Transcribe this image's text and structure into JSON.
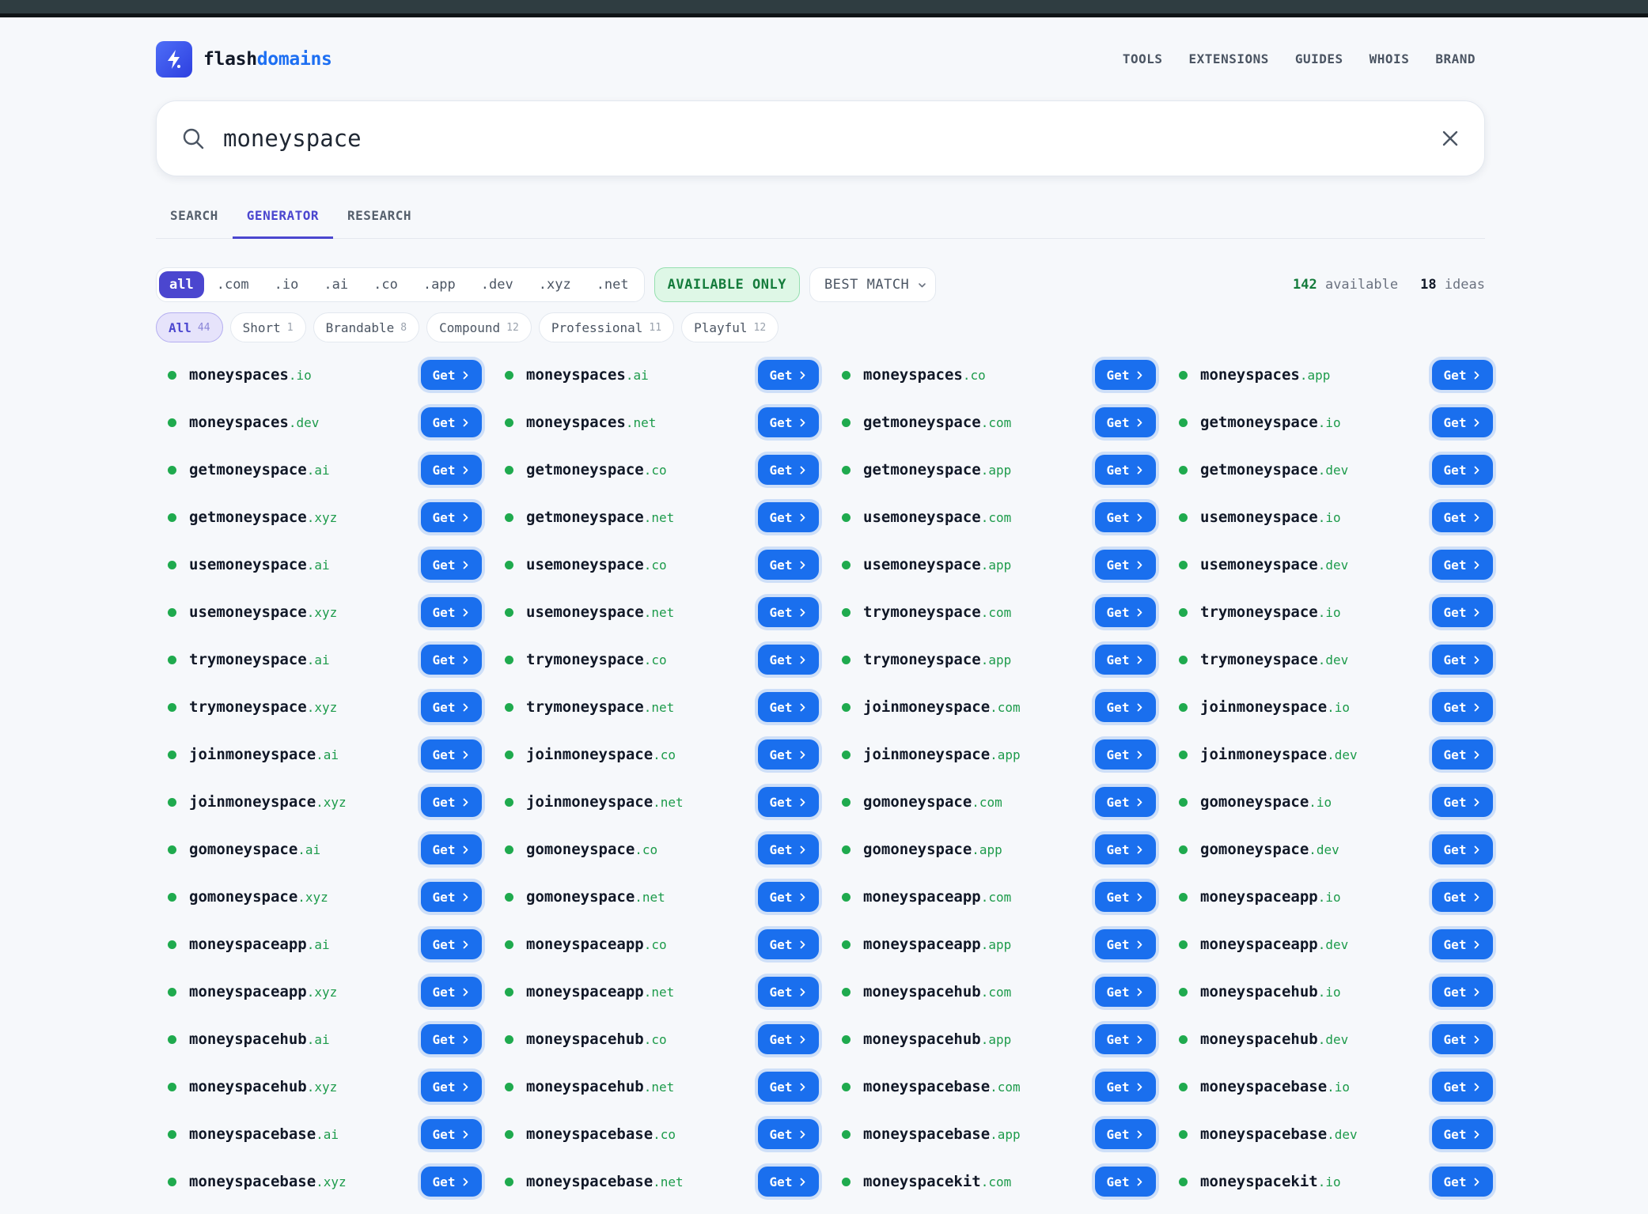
{
  "brand": {
    "name_part1": "flash",
    "name_part2": "domains",
    "accent": "#1d6ff2"
  },
  "nav": [
    "TOOLS",
    "EXTENSIONS",
    "GUIDES",
    "WHOIS",
    "BRAND"
  ],
  "search": {
    "value": "moneyspace"
  },
  "tabs": [
    {
      "label": "SEARCH",
      "active": false
    },
    {
      "label": "GENERATOR",
      "active": true
    },
    {
      "label": "RESEARCH",
      "active": false
    }
  ],
  "tld_filters": [
    {
      "label": "all",
      "active": true
    },
    {
      "label": ".com",
      "active": false
    },
    {
      "label": ".io",
      "active": false
    },
    {
      "label": ".ai",
      "active": false
    },
    {
      "label": ".co",
      "active": false
    },
    {
      "label": ".app",
      "active": false
    },
    {
      "label": ".dev",
      "active": false
    },
    {
      "label": ".xyz",
      "active": false
    },
    {
      "label": ".net",
      "active": false
    }
  ],
  "available_only_label": "AVAILABLE ONLY",
  "sort": {
    "selected": "BEST MATCH"
  },
  "stats": {
    "available_count": "142",
    "available_label": "available",
    "ideas_count": "18",
    "ideas_label": "ideas"
  },
  "categories": [
    {
      "label": "All",
      "count": "44",
      "active": true
    },
    {
      "label": "Short",
      "count": "1",
      "active": false
    },
    {
      "label": "Brandable",
      "count": "8",
      "active": false
    },
    {
      "label": "Compound",
      "count": "12",
      "active": false
    },
    {
      "label": "Professional",
      "count": "11",
      "active": false
    },
    {
      "label": "Playful",
      "count": "12",
      "active": false
    }
  ],
  "get_label": "Get",
  "status_color": "#1faa4e",
  "domains": [
    {
      "base": "moneyspaces",
      "tld": ".io"
    },
    {
      "base": "moneyspaces",
      "tld": ".ai"
    },
    {
      "base": "moneyspaces",
      "tld": ".co"
    },
    {
      "base": "moneyspaces",
      "tld": ".app"
    },
    {
      "base": "moneyspaces",
      "tld": ".dev"
    },
    {
      "base": "moneyspaces",
      "tld": ".net"
    },
    {
      "base": "getmoneyspace",
      "tld": ".com"
    },
    {
      "base": "getmoneyspace",
      "tld": ".io"
    },
    {
      "base": "getmoneyspace",
      "tld": ".ai"
    },
    {
      "base": "getmoneyspace",
      "tld": ".co"
    },
    {
      "base": "getmoneyspace",
      "tld": ".app"
    },
    {
      "base": "getmoneyspace",
      "tld": ".dev"
    },
    {
      "base": "getmoneyspace",
      "tld": ".xyz"
    },
    {
      "base": "getmoneyspace",
      "tld": ".net"
    },
    {
      "base": "usemoneyspace",
      "tld": ".com"
    },
    {
      "base": "usemoneyspace",
      "tld": ".io"
    },
    {
      "base": "usemoneyspace",
      "tld": ".ai"
    },
    {
      "base": "usemoneyspace",
      "tld": ".co"
    },
    {
      "base": "usemoneyspace",
      "tld": ".app"
    },
    {
      "base": "usemoneyspace",
      "tld": ".dev"
    },
    {
      "base": "usemoneyspace",
      "tld": ".xyz"
    },
    {
      "base": "usemoneyspace",
      "tld": ".net"
    },
    {
      "base": "trymoneyspace",
      "tld": ".com"
    },
    {
      "base": "trymoneyspace",
      "tld": ".io"
    },
    {
      "base": "trymoneyspace",
      "tld": ".ai"
    },
    {
      "base": "trymoneyspace",
      "tld": ".co"
    },
    {
      "base": "trymoneyspace",
      "tld": ".app"
    },
    {
      "base": "trymoneyspace",
      "tld": ".dev"
    },
    {
      "base": "trymoneyspace",
      "tld": ".xyz"
    },
    {
      "base": "trymoneyspace",
      "tld": ".net"
    },
    {
      "base": "joinmoneyspace",
      "tld": ".com"
    },
    {
      "base": "joinmoneyspace",
      "tld": ".io"
    },
    {
      "base": "joinmoneyspace",
      "tld": ".ai"
    },
    {
      "base": "joinmoneyspace",
      "tld": ".co"
    },
    {
      "base": "joinmoneyspace",
      "tld": ".app"
    },
    {
      "base": "joinmoneyspace",
      "tld": ".dev"
    },
    {
      "base": "joinmoneyspace",
      "tld": ".xyz"
    },
    {
      "base": "joinmoneyspace",
      "tld": ".net"
    },
    {
      "base": "gomoneyspace",
      "tld": ".com"
    },
    {
      "base": "gomoneyspace",
      "tld": ".io"
    },
    {
      "base": "gomoneyspace",
      "tld": ".ai"
    },
    {
      "base": "gomoneyspace",
      "tld": ".co"
    },
    {
      "base": "gomoneyspace",
      "tld": ".app"
    },
    {
      "base": "gomoneyspace",
      "tld": ".dev"
    },
    {
      "base": "gomoneyspace",
      "tld": ".xyz"
    },
    {
      "base": "gomoneyspace",
      "tld": ".net"
    },
    {
      "base": "moneyspaceapp",
      "tld": ".com"
    },
    {
      "base": "moneyspaceapp",
      "tld": ".io"
    },
    {
      "base": "moneyspaceapp",
      "tld": ".ai"
    },
    {
      "base": "moneyspaceapp",
      "tld": ".co"
    },
    {
      "base": "moneyspaceapp",
      "tld": ".app"
    },
    {
      "base": "moneyspaceapp",
      "tld": ".dev"
    },
    {
      "base": "moneyspaceapp",
      "tld": ".xyz"
    },
    {
      "base": "moneyspaceapp",
      "tld": ".net"
    },
    {
      "base": "moneyspacehub",
      "tld": ".com"
    },
    {
      "base": "moneyspacehub",
      "tld": ".io"
    },
    {
      "base": "moneyspacehub",
      "tld": ".ai"
    },
    {
      "base": "moneyspacehub",
      "tld": ".co"
    },
    {
      "base": "moneyspacehub",
      "tld": ".app"
    },
    {
      "base": "moneyspacehub",
      "tld": ".dev"
    },
    {
      "base": "moneyspacehub",
      "tld": ".xyz"
    },
    {
      "base": "moneyspacehub",
      "tld": ".net"
    },
    {
      "base": "moneyspacebase",
      "tld": ".com"
    },
    {
      "base": "moneyspacebase",
      "tld": ".io"
    },
    {
      "base": "moneyspacebase",
      "tld": ".ai"
    },
    {
      "base": "moneyspacebase",
      "tld": ".co"
    },
    {
      "base": "moneyspacebase",
      "tld": ".app"
    },
    {
      "base": "moneyspacebase",
      "tld": ".dev"
    },
    {
      "base": "moneyspacebase",
      "tld": ".xyz"
    },
    {
      "base": "moneyspacebase",
      "tld": ".net"
    },
    {
      "base": "moneyspacekit",
      "tld": ".com"
    },
    {
      "base": "moneyspacekit",
      "tld": ".io"
    }
  ]
}
